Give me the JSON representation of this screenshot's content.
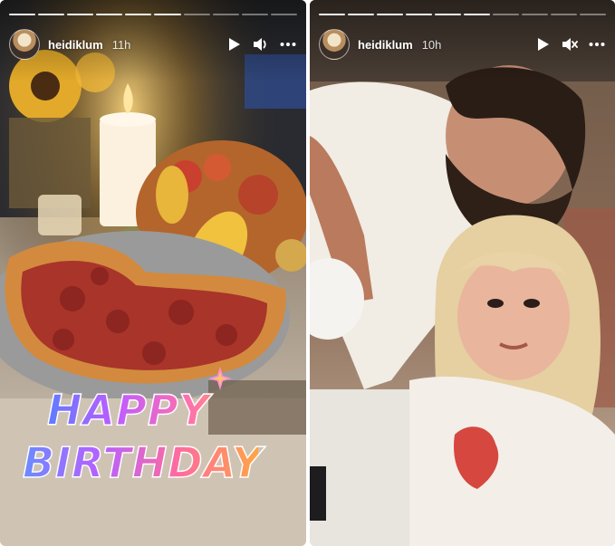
{
  "stories": [
    {
      "username": "heidiklum",
      "time": "11h",
      "progress": {
        "segments": 10,
        "current": 6
      },
      "icons": [
        "play-icon",
        "volume-icon",
        "more-icon"
      ],
      "sticker": {
        "line1": "HAPPY",
        "line2": "BIRTHDAY"
      }
    },
    {
      "username": "heidiklum",
      "time": "10h",
      "progress": {
        "segments": 10,
        "current": 6
      },
      "icons": [
        "play-icon",
        "muted-icon",
        "more-icon"
      ]
    }
  ],
  "colors": {
    "text": "#ffffff",
    "progress_done": "#ffffff",
    "progress_pending": "rgba(255,255,255,0.4)"
  }
}
